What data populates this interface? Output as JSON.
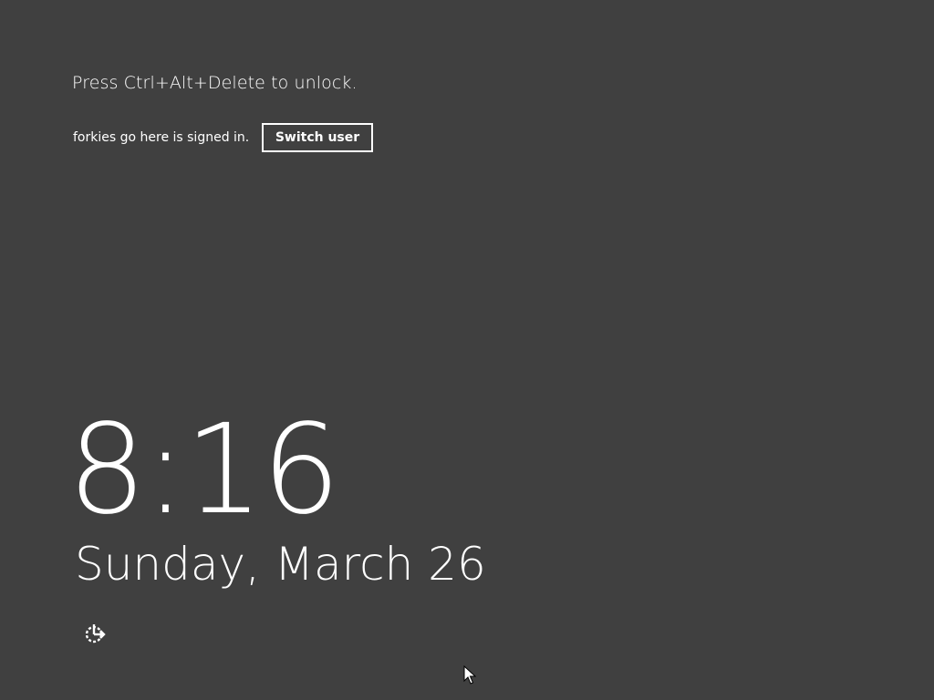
{
  "lock_screen": {
    "prompt": "Press Ctrl+Alt+Delete to unlock.",
    "signed_in_text": "forkies go here is signed in.",
    "switch_user_label": "Switch user",
    "time": "8:16",
    "date": "Sunday, March 26",
    "ease_of_access_icon": "ease-of-access-icon"
  },
  "colors": {
    "background": "#404040",
    "foreground": "#ffffff"
  }
}
